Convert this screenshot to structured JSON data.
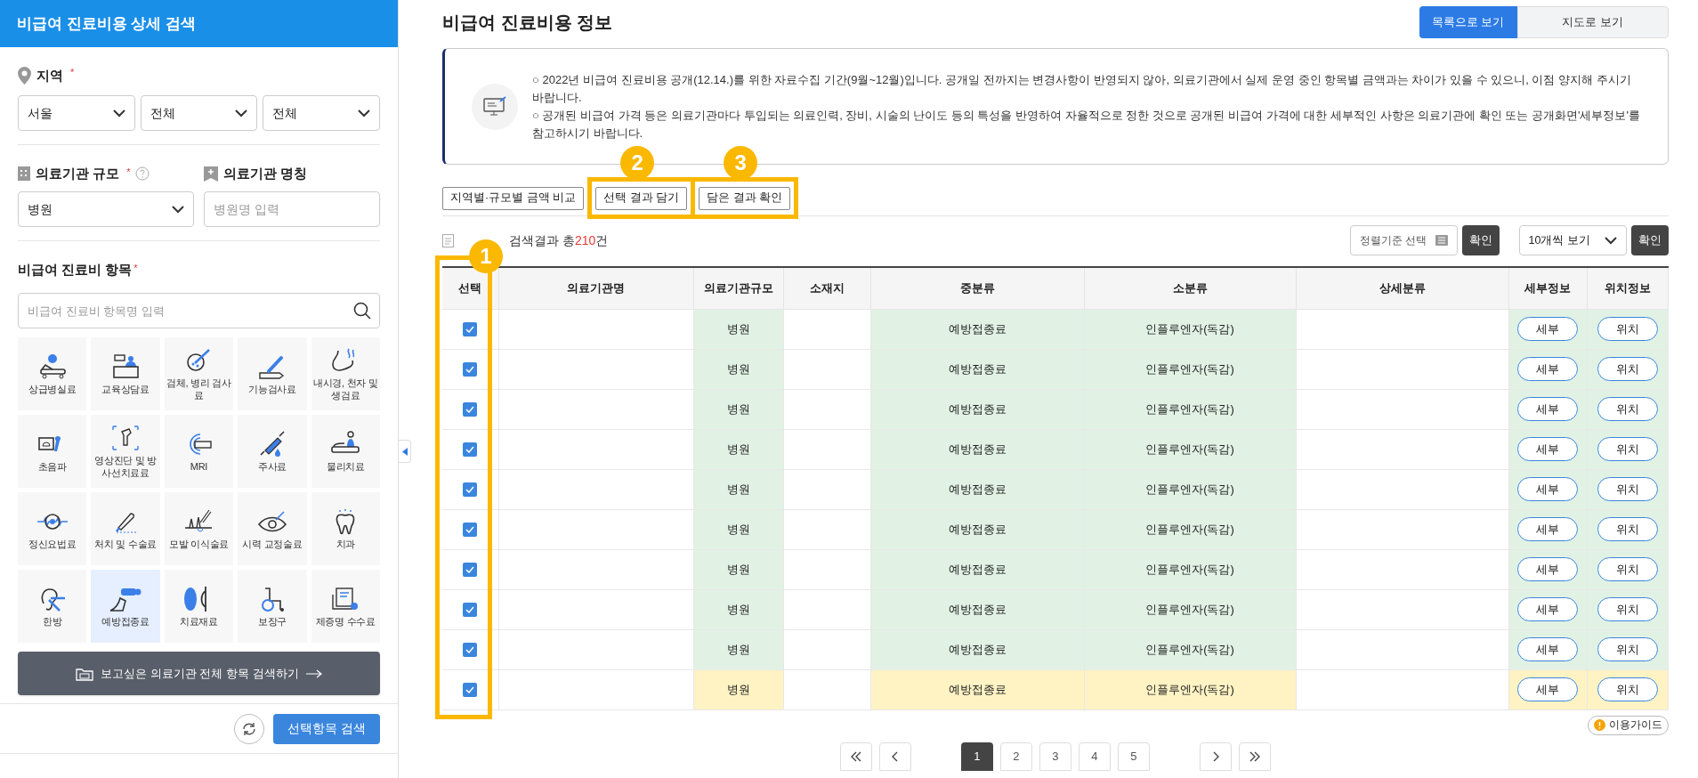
{
  "sidebar": {
    "title": "비급여 진료비용 상세 검색",
    "region": {
      "label": "지역",
      "required_mark": "*",
      "selects": [
        "서울",
        "전체",
        "전체"
      ]
    },
    "scale": {
      "label": "의료기관 규모",
      "required_mark": "*",
      "value": "병원"
    },
    "name": {
      "label": "의료기관 명칭",
      "placeholder": "병원명 입력"
    },
    "items": {
      "label": "비급여 진료비 항목",
      "required_mark": "*",
      "placeholder": "비급여 진료비 항목명 입력",
      "tiles": [
        {
          "label": "상급병실료",
          "selected": false
        },
        {
          "label": "교육상담료",
          "selected": false
        },
        {
          "label": "검체, 병리 검사료",
          "selected": false
        },
        {
          "label": "기능검사료",
          "selected": false
        },
        {
          "label": "내시경, 천자 및 생검료",
          "selected": false
        },
        {
          "label": "초음파",
          "selected": false
        },
        {
          "label": "영상진단 및 방사선치료료",
          "selected": false
        },
        {
          "label": "MRI",
          "selected": false
        },
        {
          "label": "주사료",
          "selected": false
        },
        {
          "label": "물리치료",
          "selected": false
        },
        {
          "label": "정신요법료",
          "selected": false
        },
        {
          "label": "처치 및 수술료",
          "selected": false
        },
        {
          "label": "모발 이식술료",
          "selected": false
        },
        {
          "label": "시력 교정술료",
          "selected": false
        },
        {
          "label": "치과",
          "selected": false
        },
        {
          "label": "한방",
          "selected": false
        },
        {
          "label": "예방접종료",
          "selected": true
        },
        {
          "label": "치료재료",
          "selected": false
        },
        {
          "label": "보장구",
          "selected": false
        },
        {
          "label": "제증명 수수료",
          "selected": false
        }
      ]
    },
    "all_search_button": "보고싶은 의료기관 전체 항목 검색하기",
    "search_button": "선택항목 검색"
  },
  "main": {
    "title": "비급여 진료비용 정보",
    "view_tabs": [
      {
        "label": "목록으로 보기",
        "selected": true
      },
      {
        "label": "지도로 보기",
        "selected": false
      }
    ],
    "notice": [
      "○ 2022년 비급여 진료비용 공개(12.14.)를 위한 자료수집 기간(9월~12월)입니다. 공개일 전까지는 변경사항이 반영되지 않아, 의료기관에서 실제 운영 중인 항목별 금액과는 차이가 있을 수 있으니, 이점 양지해 주시기 바랍니다.",
      "○ 공개된 비급여 가격 등은 의료기관마다 투입되는 의료인력, 장비, 시술의 난이도 등의 특성을 반영하여 자율적으로 정한 것으로 공개된 비급여 가격에 대한 세부적인 사항은 의료기관에 확인 또는 공개화면'세부정보'를 참고하시기 바랍니다."
    ],
    "actions": [
      {
        "label": "지역별·규모별 금액 비교"
      },
      {
        "label": "선택 결과 담기",
        "marker": "2"
      },
      {
        "label": "담은 결과 확인",
        "marker": "3"
      }
    ],
    "result": {
      "label": "검색결과 총",
      "count": "210",
      "unit": "건"
    },
    "sort": {
      "value": "정렬기준 선택",
      "confirm": "확인"
    },
    "page_size": {
      "value": "10개씩 보기",
      "confirm": "확인"
    },
    "table_marker": "1",
    "table": {
      "columns": [
        "선택",
        "의료기관명",
        "의료기관규모",
        "소재지",
        "중분류",
        "소분류",
        "상세분류",
        "세부정보",
        "위치정보"
      ],
      "rows": [
        {
          "checked": true,
          "highlighted": false,
          "scale": "병원",
          "category": "예방접종료",
          "subcategory": "인플루엔자(독감)",
          "detail": "세부",
          "location": "위치"
        },
        {
          "checked": true,
          "highlighted": false,
          "scale": "병원",
          "category": "예방접종료",
          "subcategory": "인플루엔자(독감)",
          "detail": "세부",
          "location": "위치"
        },
        {
          "checked": true,
          "highlighted": false,
          "scale": "병원",
          "category": "예방접종료",
          "subcategory": "인플루엔자(독감)",
          "detail": "세부",
          "location": "위치"
        },
        {
          "checked": true,
          "highlighted": false,
          "scale": "병원",
          "category": "예방접종료",
          "subcategory": "인플루엔자(독감)",
          "detail": "세부",
          "location": "위치"
        },
        {
          "checked": true,
          "highlighted": false,
          "scale": "병원",
          "category": "예방접종료",
          "subcategory": "인플루엔자(독감)",
          "detail": "세부",
          "location": "위치"
        },
        {
          "checked": true,
          "highlighted": false,
          "scale": "병원",
          "category": "예방접종료",
          "subcategory": "인플루엔자(독감)",
          "detail": "세부",
          "location": "위치"
        },
        {
          "checked": true,
          "highlighted": false,
          "scale": "병원",
          "category": "예방접종료",
          "subcategory": "인플루엔자(독감)",
          "detail": "세부",
          "location": "위치"
        },
        {
          "checked": true,
          "highlighted": false,
          "scale": "병원",
          "category": "예방접종료",
          "subcategory": "인플루엔자(독감)",
          "detail": "세부",
          "location": "위치"
        },
        {
          "checked": true,
          "highlighted": false,
          "scale": "병원",
          "category": "예방접종료",
          "subcategory": "인플루엔자(독감)",
          "detail": "세부",
          "location": "위치"
        },
        {
          "checked": true,
          "highlighted": true,
          "scale": "병원",
          "category": "예방접종료",
          "subcategory": "인플루엔자(독감)",
          "detail": "세부",
          "location": "위치"
        }
      ]
    },
    "guide_button": "이용가이드",
    "pages": [
      {
        "label": "1",
        "selected": true
      },
      {
        "label": "2",
        "selected": false
      },
      {
        "label": "3",
        "selected": false
      },
      {
        "label": "4",
        "selected": false
      },
      {
        "label": "5",
        "selected": false
      }
    ]
  }
}
